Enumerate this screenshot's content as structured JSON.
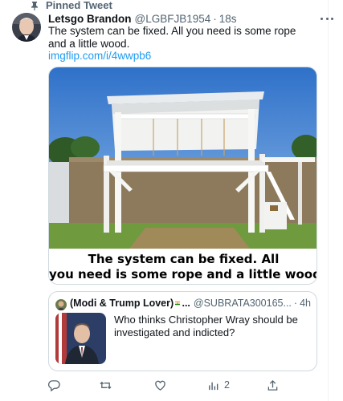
{
  "pinned": {
    "label": "Pinned Tweet",
    "icon": "pin-icon"
  },
  "tweet": {
    "display_name": "Letsgo Brandon",
    "handle": "@LGBFJB1954",
    "separator": "·",
    "time": "18s",
    "text": "The system can be fixed. All you need is some rope and a little wood.",
    "link": "imgflip.com/i/4wwpb6",
    "media_caption_line1": "The system can be fixed. All",
    "media_caption_line2": "you need is some rope and a little wood"
  },
  "quote": {
    "display_name": "(Modi & Trump Lover)",
    "ellipsis": "...",
    "handle": "@SUBRATA300165...",
    "separator": "·",
    "time": "4h",
    "text": "Who thinks Christopher Wray should be investigated and indicted?"
  },
  "actions": {
    "reply": {
      "icon": "reply-icon",
      "count": ""
    },
    "retweet": {
      "icon": "retweet-icon",
      "count": ""
    },
    "like": {
      "icon": "heart-icon",
      "count": ""
    },
    "analytics": {
      "icon": "analytics-icon",
      "count": "2"
    },
    "share": {
      "icon": "share-icon",
      "count": ""
    }
  },
  "colors": {
    "link": "#1d9bf0",
    "secondary_text": "#536471",
    "border": "#cfd9de"
  }
}
